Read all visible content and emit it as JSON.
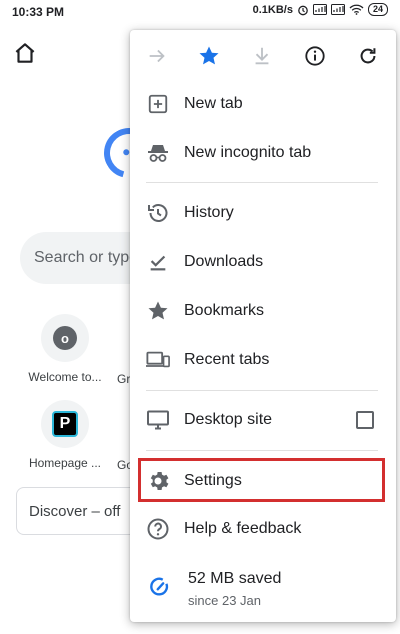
{
  "status_bar": {
    "time": "10:33 PM",
    "network_speed": "0.1KB/s",
    "battery": "24"
  },
  "background": {
    "search_placeholder": "Search or type",
    "tiles": [
      {
        "label": "Welcome to...",
        "letter": "o"
      },
      {
        "label": "Homepage ...",
        "letter": "P"
      }
    ],
    "tile_peeks": [
      "Gr",
      "Go"
    ],
    "discover_label": "Discover – off"
  },
  "menu": {
    "items": [
      {
        "label": "New tab"
      },
      {
        "label": "New incognito tab"
      },
      {
        "label": "History"
      },
      {
        "label": "Downloads"
      },
      {
        "label": "Bookmarks"
      },
      {
        "label": "Recent tabs"
      },
      {
        "label": "Desktop site"
      },
      {
        "label": "Settings"
      },
      {
        "label": "Help & feedback"
      }
    ],
    "saved": {
      "amount": "52 MB saved",
      "since": "since 23 Jan"
    }
  },
  "colors": {
    "accent_blue": "#1a73e8",
    "icon_gray": "#5f6368",
    "disabled_gray": "#bdc1c6",
    "highlight_red": "#d32f2f"
  }
}
